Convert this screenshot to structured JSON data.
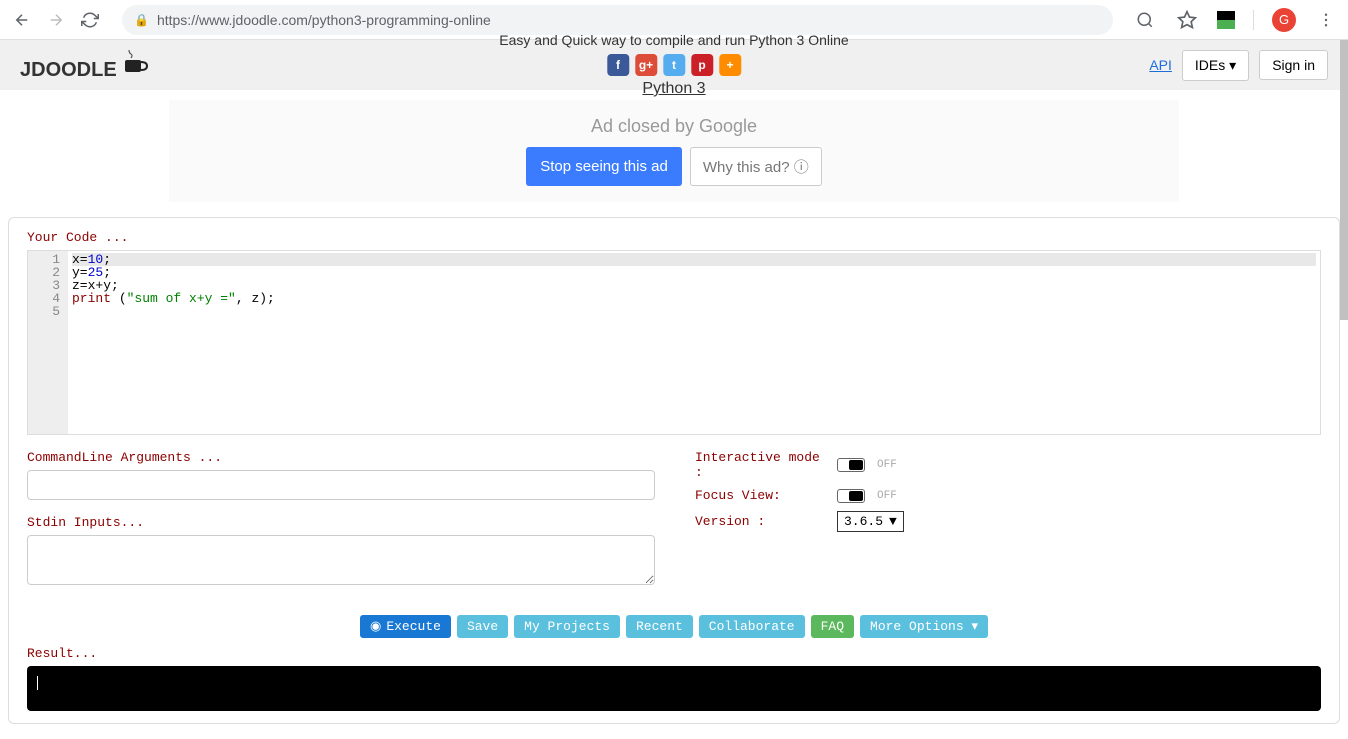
{
  "browser": {
    "url": "https://www.jdoodle.com/python3-programming-online",
    "avatar_letter": "G"
  },
  "header": {
    "logo_text": "JDOODLE",
    "tagline": "Easy and Quick way to compile and run Python 3 Online",
    "lang_title": "Python 3",
    "api": "API",
    "ides": "IDEs",
    "signin": "Sign in"
  },
  "social": {
    "fb": "f",
    "gp": "g+",
    "tw": "t",
    "pn": "p",
    "pl": "+"
  },
  "ad": {
    "text_prefix": "Ad closed by ",
    "text_brand": "Google",
    "stop": "Stop seeing this ad",
    "why": "Why this ad?"
  },
  "editor": {
    "label": "Your Code ...",
    "gutter": [
      "1",
      "2",
      "3",
      "4",
      "5"
    ],
    "lines": {
      "l1_a": "x=",
      "l1_b": "10",
      "l1_c": ";",
      "l2_a": "y=",
      "l2_b": "25",
      "l2_c": ";",
      "l3": "z=x+y;",
      "l4_a": "print",
      "l4_b": " (",
      "l4_c": "\"sum of x+y =\"",
      "l4_d": ", z);"
    }
  },
  "inputs": {
    "cmdline_label": "CommandLine Arguments ...",
    "stdin_label": "Stdin Inputs..."
  },
  "toggles": {
    "interactive_label": "Interactive mode :",
    "interactive_state": "OFF",
    "focus_label": "Focus View:",
    "focus_state": "OFF",
    "version_label": "Version :",
    "version_value": "3.6.5"
  },
  "actions": {
    "execute": "Execute",
    "save": "Save",
    "projects": "My Projects",
    "recent": "Recent",
    "collab": "Collaborate",
    "faq": "FAQ",
    "more": "More Options"
  },
  "result": {
    "label": "Result..."
  }
}
